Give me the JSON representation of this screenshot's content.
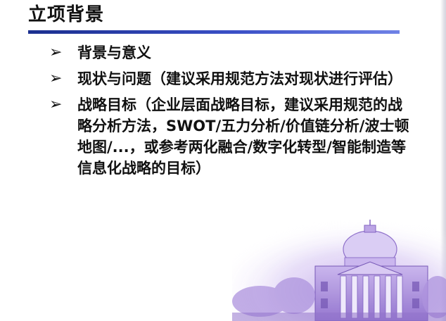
{
  "slide": {
    "title": "立项背景",
    "bullet_icon": "arrow-bullet-icon",
    "bullets": [
      {
        "text": "背景与意义"
      },
      {
        "text": "现状与问题（建议采用规范方法对现状进行评估）"
      },
      {
        "text": "战略目标（企业层面战略目标，建议采用规范的战略分析方法，SWOT/五力分析/价值链分析/波士顿地图/...，或参考两化融合/数字化转型/智能制造等信息化战略的目标）"
      }
    ]
  },
  "colors": {
    "title_rule": "#2e43b8",
    "text": "#111111",
    "decor": "#9a7fd0"
  },
  "decor_image": "purple-campus-building-watermark"
}
